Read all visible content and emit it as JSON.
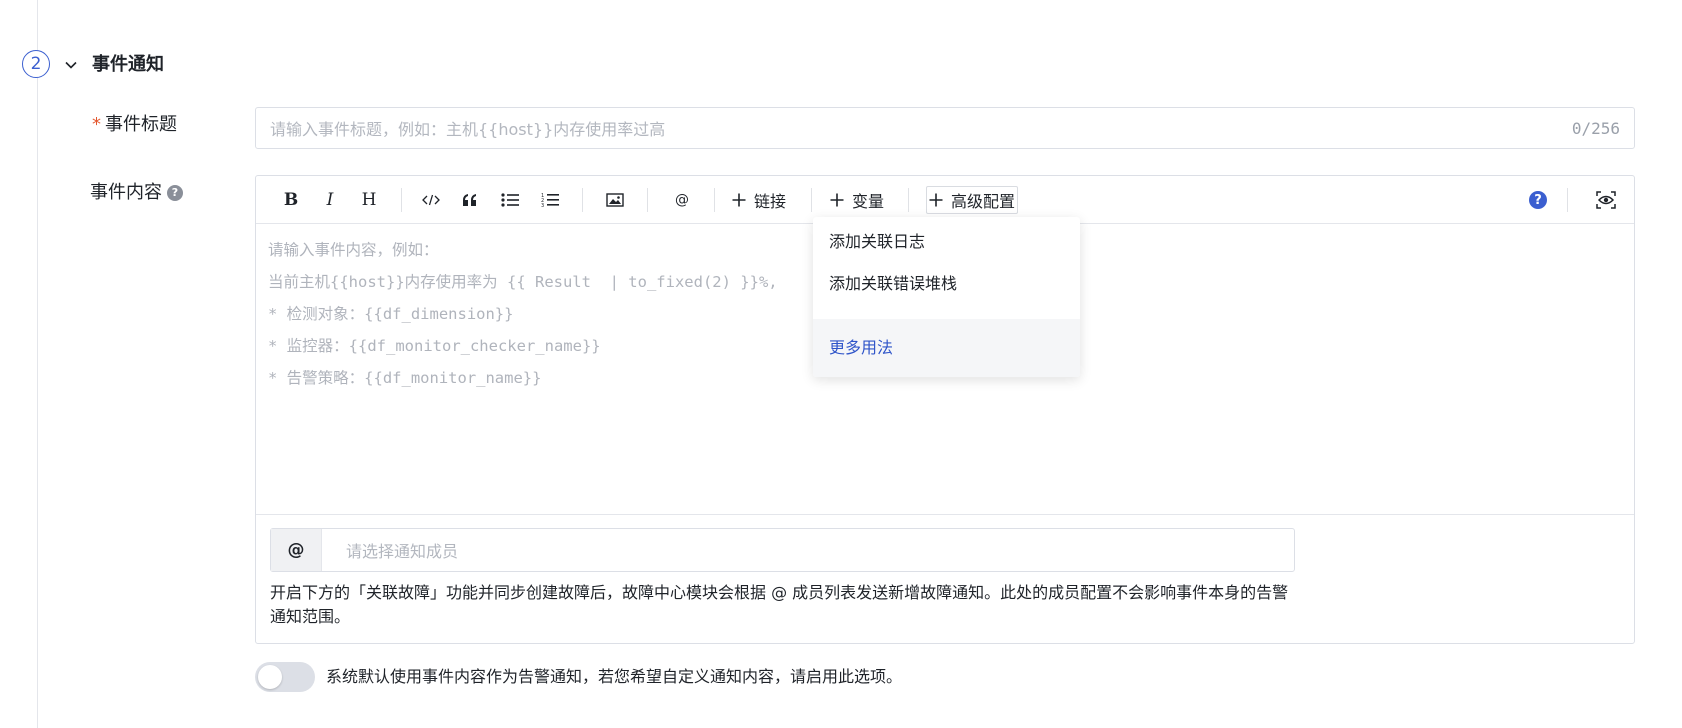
{
  "section": {
    "step_number": "2",
    "title": "事件通知"
  },
  "event_title": {
    "required_mark": "*",
    "label": "事件标题",
    "placeholder": "请输入事件标题，例如：主机{{host}}内存使用率过高",
    "counter": "0/256"
  },
  "event_content": {
    "label": "事件内容",
    "help_icon": "question-circle-icon",
    "toolbar": {
      "bold": "B",
      "italic": "I",
      "heading": "H",
      "at": "@",
      "link_label": "链接",
      "variable_label": "变量",
      "advanced_label": "高级配置",
      "help": "?"
    },
    "placeholder_lines": [
      "请输入事件内容，例如：",
      "当前主机{{host}}内存使用率为 {{ Result  | to_fixed(2) }}%,",
      "* 检测对象：{{df_dimension}}",
      "* 监控器：{{df_monitor_checker_name}}",
      "* 告警策略：{{df_monitor_name}}"
    ],
    "member_at": "@",
    "member_placeholder": "请选择通知成员",
    "member_note": "开启下方的「关联故障」功能并同步创建故障后，故障中心模块会根据 @ 成员列表发送新增故障通知。此处的成员配置不会影响事件本身的告警通知范围。"
  },
  "advanced_dropdown": {
    "items": [
      "添加关联日志",
      "添加关联错误堆栈"
    ],
    "more_link": "更多用法"
  },
  "custom_notify": {
    "enabled": false,
    "label": "系统默认使用事件内容作为告警通知，若您希望自定义通知内容，请启用此选项。"
  },
  "colors": {
    "accent": "#3b5fd0",
    "link": "#2f55c9",
    "required": "#e4572e",
    "placeholder": "#b3b7bf"
  }
}
